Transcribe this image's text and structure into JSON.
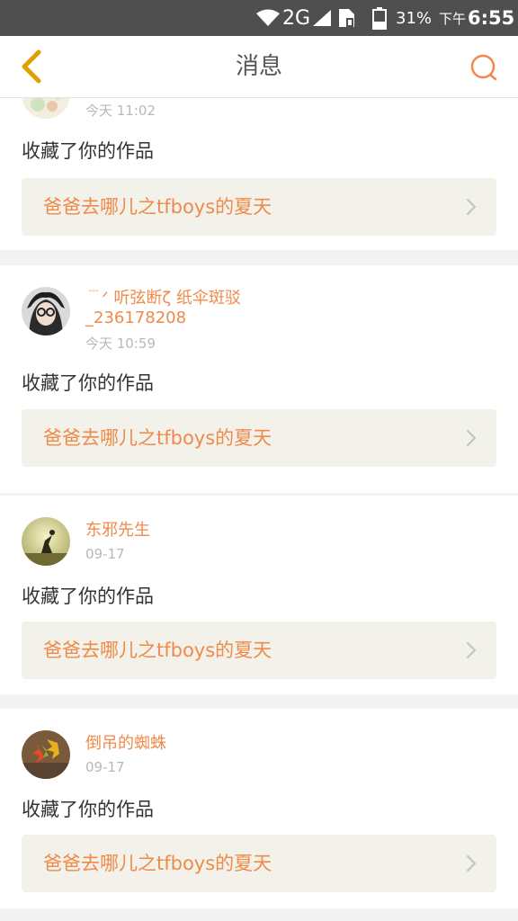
{
  "status_bar": {
    "network": "2G",
    "battery_percent": "31%",
    "ampm": "下午",
    "time": "6:55"
  },
  "header": {
    "title": "消息",
    "back_icon": "chevron-left-icon",
    "search_icon": "search-icon"
  },
  "colors": {
    "accent": "#f08a4b",
    "back_icon": "#e0a000",
    "card_inner_bg": "#f2f2ea"
  },
  "messages": [
    {
      "user": "",
      "time": "今天 11:02",
      "action": "收藏了你的作品",
      "work_title": "爸爸去哪儿之tfboys的夏天"
    },
    {
      "user": "﹉ᐟ  听弦断ζ 纸伞斑驳_236178208",
      "time": "今天 10:59",
      "action": "收藏了你的作品",
      "work_title": "爸爸去哪儿之tfboys的夏天"
    },
    {
      "user": "东邪先生",
      "time": "09-17",
      "action": "收藏了你的作品",
      "work_title": "爸爸去哪儿之tfboys的夏天"
    },
    {
      "user": "倒吊的蜘蛛",
      "time": "09-17",
      "action": "收藏了你的作品",
      "work_title": "爸爸去哪儿之tfboys的夏天"
    }
  ]
}
